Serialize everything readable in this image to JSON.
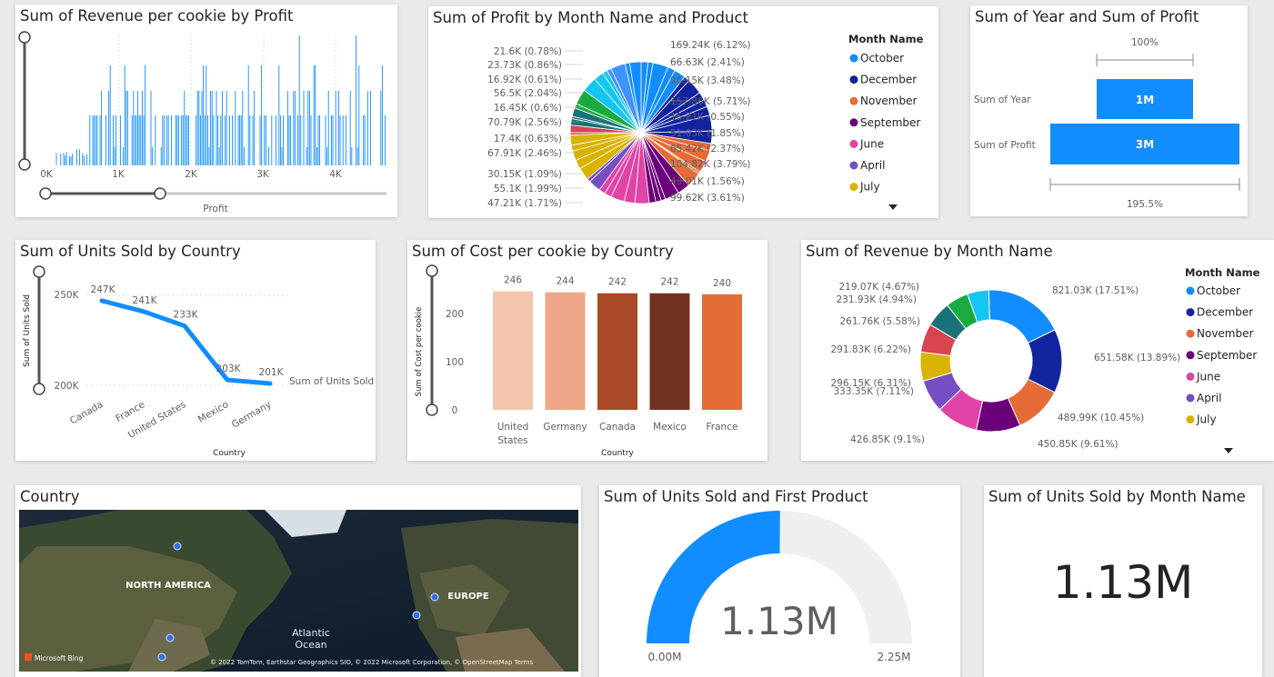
{
  "colors": {
    "blue": "#118dff",
    "darkblue": "#12239e",
    "orange": "#e66c37",
    "purple": "#6b007b",
    "pink": "#e044a7",
    "violet": "#744ec2",
    "gold": "#d9b300",
    "red": "#d64550",
    "teal": "#197278",
    "green": "#1aab40",
    "cyan": "#15c6f4",
    "lightblue": "#4092ff"
  },
  "v1": {
    "title": "Sum of Revenue per cookie by Profit",
    "xaxis_label": "Profit",
    "ticks": [
      "0K",
      "1K",
      "2K",
      "3K",
      "4K"
    ]
  },
  "v2": {
    "title": "Sum of Profit by Month Name and Product",
    "legend_title": "Month Name",
    "legend": [
      "October",
      "December",
      "November",
      "September",
      "June",
      "April",
      "July"
    ],
    "labels_right": [
      "169.24K (6.12%)",
      "66.63K (2.41%)",
      "96.15K (3.48%)",
      "157.86K (5.71%)",
      "15.21K (0.55%)",
      "51.03K (1.85%)",
      "65.42K (2.37%)",
      "104.82K (3.79%)",
      "43.01K (1.56%)",
      "99.62K (3.61%)"
    ],
    "labels_left": [
      "21.6K (0.78%)",
      "23.73K (0.86%)",
      "16.92K (0.61%)",
      "56.5K (2.04%)",
      "16.45K (0.6%)",
      "70.79K (2.56%)",
      "17.4K (0.63%)",
      "67.91K (2.46%)",
      "30.15K (1.09%)",
      "55.1K (1.99%)",
      "47.21K (1.71%)"
    ]
  },
  "v3": {
    "title": "Sum of Year and Sum of Profit",
    "top_pct": "100%",
    "bottom_pct": "195.5%",
    "rows": [
      {
        "label": "Sum of Year",
        "value": "1M"
      },
      {
        "label": "Sum of Profit",
        "value": "3M"
      }
    ]
  },
  "v4": {
    "title": "Sum of Units Sold by Country",
    "ylabel": "Sum of Units Sold",
    "xlabel": "Country",
    "series_label": "Sum of Units Sold",
    "yticks": [
      "250K",
      "200K"
    ]
  },
  "v5": {
    "title": "Sum of Cost per cookie by Country",
    "ylabel": "Sum of Cost per cookie",
    "xlabel": "Country",
    "yticks": [
      "200",
      "100",
      "0"
    ],
    "cat_labels": [
      [
        "United",
        "States"
      ],
      [
        "Germany"
      ],
      [
        "Canada"
      ],
      [
        "Mexico"
      ],
      [
        "France"
      ]
    ]
  },
  "v6": {
    "title": "Sum of Revenue by Month Name",
    "legend_title": "Month Name",
    "legend": [
      "October",
      "December",
      "November",
      "September",
      "June",
      "April",
      "July"
    ]
  },
  "v7": {
    "title": "Country",
    "regions": [
      "NORTH AMERICA",
      "EUROPE"
    ],
    "ocean": [
      "Atlantic",
      "Ocean"
    ],
    "bing": "Microsoft Bing",
    "attribution": "© 2022 TomTom, Earthstar Geographics SIO, © 2022 Microsoft Corporation, © OpenStreetMap  Terms"
  },
  "v8": {
    "title": "Sum of Units Sold and First Product",
    "value": "1.13M",
    "min": "0.00M",
    "max": "2.25M",
    "fraction": 0.502
  },
  "v9": {
    "title": "Sum of Units Sold by Month Name",
    "value": "1.13M"
  },
  "chart_data": [
    {
      "type": "bar",
      "title": "Sum of Cost per cookie by Country",
      "categories": [
        "United States",
        "Germany",
        "Canada",
        "Mexico",
        "France"
      ],
      "values": [
        246,
        244,
        242,
        242,
        240
      ],
      "xlabel": "Country",
      "ylabel": "Sum of Cost per cookie",
      "ylim": [
        0,
        250
      ]
    },
    {
      "type": "line",
      "title": "Sum of Units Sold by Country",
      "categories": [
        "Canada",
        "France",
        "United States",
        "Mexico",
        "Germany"
      ],
      "values": [
        247,
        241,
        233,
        203,
        201
      ],
      "value_labels": [
        "247K",
        "241K",
        "233K",
        "203K",
        "201K"
      ],
      "xlabel": "Country",
      "ylabel": "Sum of Units Sold"
    },
    {
      "type": "pie",
      "title": "Sum of Revenue by Month Name",
      "slices": [
        {
          "value": 821.03,
          "label": "821.03K (17.51%)"
        },
        {
          "value": 651.58,
          "label": "651.58K (13.89%)"
        },
        {
          "value": 489.99,
          "label": "489.99K (10.45%)"
        },
        {
          "value": 450.85,
          "label": "450.85K (9.61%)"
        },
        {
          "value": 426.85,
          "label": "426.85K (9.1%)"
        },
        {
          "value": 333.35,
          "label": "333.35K (7.11%)"
        },
        {
          "value": 296.15,
          "label": "296.15K (6.31%)"
        },
        {
          "value": 291.83,
          "label": "291.83K (6.22%)"
        },
        {
          "value": 261.76,
          "label": "261.76K (5.58%)"
        },
        {
          "value": 231.93,
          "label": "231.93K (4.94%)"
        },
        {
          "value": 219.07,
          "label": "219.07K (4.67%)"
        }
      ]
    }
  ]
}
